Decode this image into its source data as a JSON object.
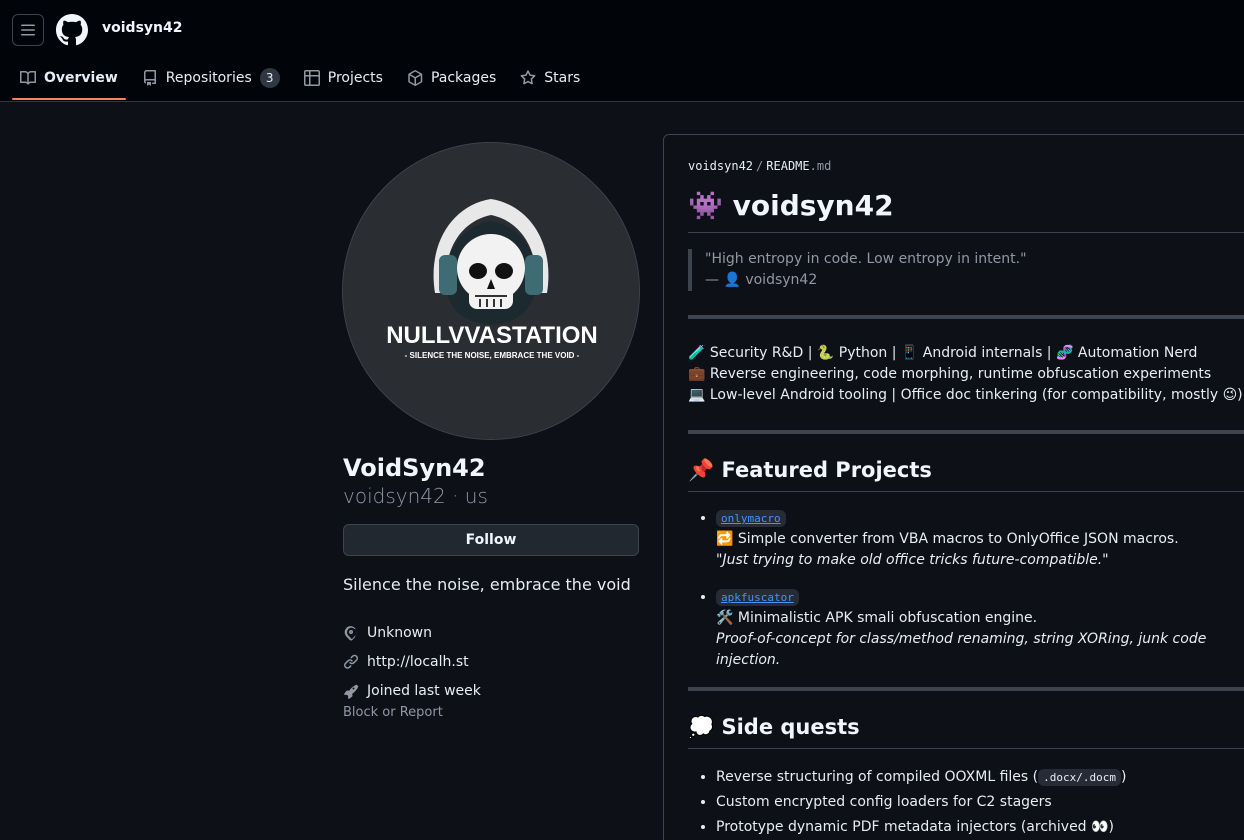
{
  "header": {
    "username": "voidsyn42",
    "tabs": [
      {
        "label": "Overview"
      },
      {
        "label": "Repositories",
        "count": "3"
      },
      {
        "label": "Projects"
      },
      {
        "label": "Packages"
      },
      {
        "label": "Stars"
      }
    ]
  },
  "profile": {
    "avatar_brand": "NULLVVASTATION",
    "avatar_tagline": "- SILENCE THE NOISE, EMBRACE THE VOID -",
    "name": "VoidSyn42",
    "login_line": "voidsyn42 · us",
    "follow_label": "Follow",
    "bio": "Silence the noise, embrace the void",
    "location": "Unknown",
    "website": "http://localh.st",
    "joined": "Joined last week",
    "block_report": "Block or Report"
  },
  "readme": {
    "owner": "voidsyn42",
    "file": "README",
    "ext": ".md",
    "title": "👾 voidsyn42",
    "quote_line1": "\"High entropy in code. Low entropy in intent.\"",
    "quote_line2": "— 👤 voidsyn42",
    "about_lines": [
      "🧪 Security R&D | 🐍 Python | 📱 Android internals | 🧬 Automation Nerd",
      "💼 Reverse engineering, code morphing, runtime obfuscation experiments",
      "💻 Low-level Android tooling | Office doc tinkering (for compatibility, mostly 😉)"
    ],
    "featured_title": "📌 Featured Projects",
    "projects": [
      {
        "name": "onlymacro",
        "desc": "🔁 Simple converter from VBA macros to OnlyOffice JSON macros.",
        "note": "\"Just trying to make old office tricks future-compatible.\""
      },
      {
        "name": "apkfuscator",
        "desc": "🛠️ Minimalistic APK smali obfuscation engine.",
        "note": "Proof-of-concept for class/method renaming, string XORing, junk code injection."
      }
    ],
    "side_title": "💭 Side quests",
    "side_quests": [
      {
        "pre": "Reverse structuring of compiled OOXML files (",
        "code": ".docx/.docm",
        "post": ")"
      },
      {
        "pre": "Custom encrypted config loaders for C2 stagers",
        "code": "",
        "post": ""
      },
      {
        "pre": "Prototype dynamic PDF metadata injectors (archived 👀)",
        "code": "",
        "post": ""
      }
    ]
  }
}
